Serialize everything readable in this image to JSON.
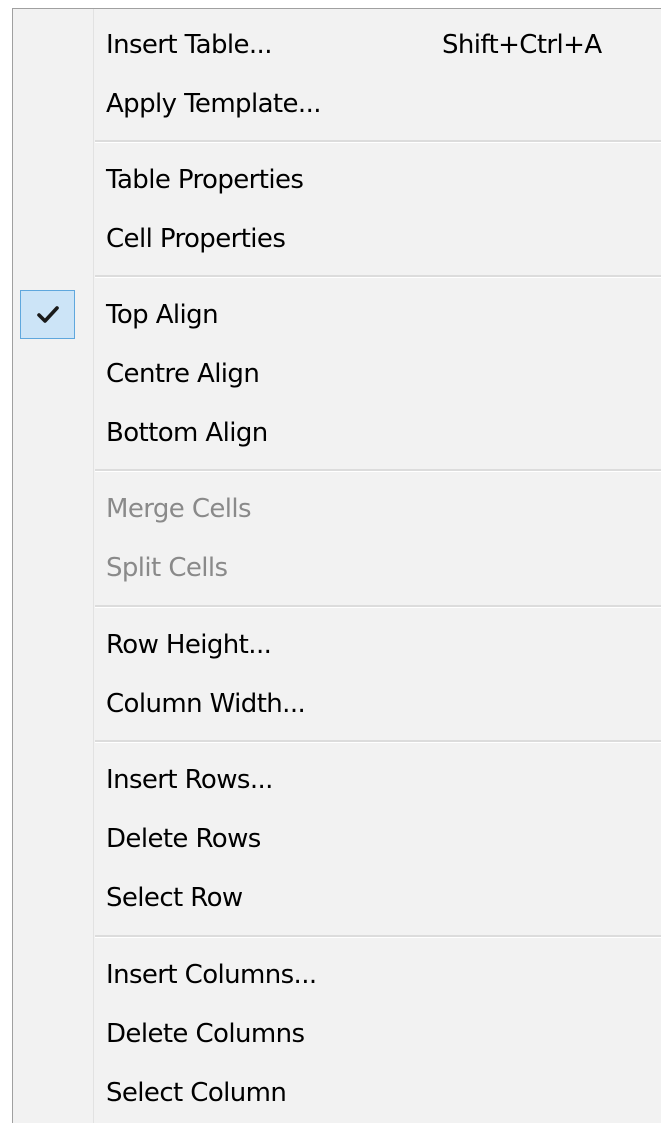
{
  "menu": {
    "insert_table": {
      "label": "Insert Table...",
      "shortcut": "Shift+Ctrl+A"
    },
    "apply_template": {
      "label": "Apply Template..."
    },
    "table_properties": {
      "label": "Table Properties"
    },
    "cell_properties": {
      "label": "Cell Properties"
    },
    "top_align": {
      "label": "Top Align",
      "checked": true,
      "check_icon": "checkmark-icon"
    },
    "centre_align": {
      "label": "Centre Align"
    },
    "bottom_align": {
      "label": "Bottom Align"
    },
    "merge_cells": {
      "label": "Merge Cells",
      "disabled": true
    },
    "split_cells": {
      "label": "Split Cells",
      "disabled": true
    },
    "row_height": {
      "label": "Row Height..."
    },
    "column_width": {
      "label": "Column Width..."
    },
    "insert_rows": {
      "label": "Insert Rows..."
    },
    "delete_rows": {
      "label": "Delete Rows"
    },
    "select_row": {
      "label": "Select Row"
    },
    "insert_columns": {
      "label": "Insert Columns..."
    },
    "delete_columns": {
      "label": "Delete Columns"
    },
    "select_column": {
      "label": "Select Column"
    }
  },
  "colors": {
    "menu_background": "#f2f2f2",
    "disabled_text": "#8a8a8a",
    "check_highlight": "#cce4f7",
    "check_border": "#5fa7dd"
  }
}
